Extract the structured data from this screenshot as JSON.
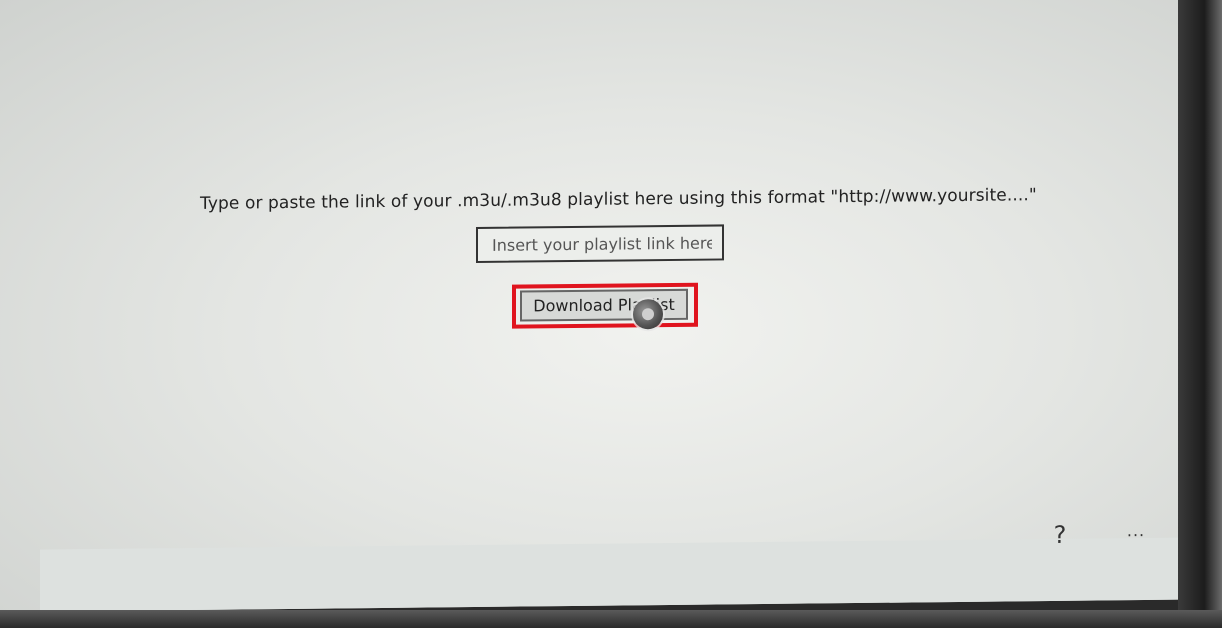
{
  "instruction": {
    "text": "Type or paste the link of your .m3u/.m3u8 playlist here using this format \"http://www.yoursite....\""
  },
  "playlist_input": {
    "value": "",
    "placeholder": "Insert your playlist link here"
  },
  "download_button": {
    "label": "Download Playlist"
  },
  "highlight": {
    "color": "#e0141e"
  },
  "footer": {
    "help_label": "?",
    "more_label": "..."
  },
  "icons": {
    "cursor": "busy-cursor-icon"
  }
}
